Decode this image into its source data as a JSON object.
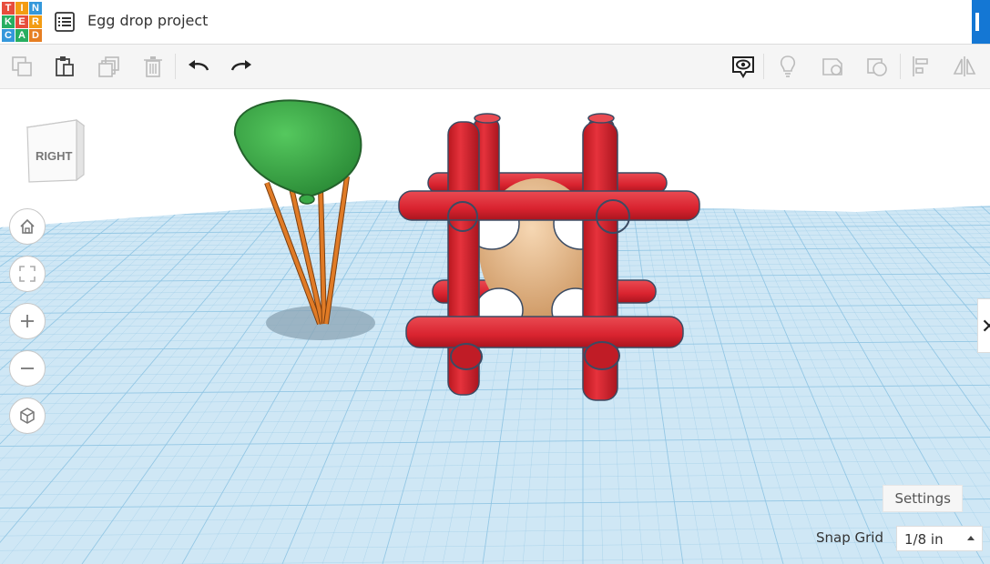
{
  "header": {
    "logo_letters": [
      "T",
      "I",
      "N",
      "K",
      "E",
      "R",
      "C",
      "A",
      "D"
    ],
    "logo_colors": [
      "#e74c3c",
      "#f39c12",
      "#3498db",
      "#27ae60",
      "#e74c3c",
      "#f39c12",
      "#3498db",
      "#27ae60",
      "#e67e22"
    ],
    "project_title": "Egg drop project"
  },
  "toolbar": {
    "left_actions": [
      "copy-icon",
      "paste-icon",
      "duplicate-icon",
      "delete-icon",
      "undo-icon",
      "redo-icon"
    ],
    "right_actions": [
      "show-notes-icon",
      "lightbulb-icon",
      "note-icon",
      "shape-icon",
      "align-icon",
      "mirror-icon"
    ]
  },
  "viewcube": {
    "face_label": "RIGHT"
  },
  "nav": [
    "home-icon",
    "fit-icon",
    "zoom-in-icon",
    "zoom-out-icon",
    "perspective-icon"
  ],
  "bottom": {
    "settings_label": "Settings",
    "snap_label": "Snap Grid",
    "snap_value": "1/8 in"
  },
  "colors": {
    "grid_bg": "#cfe7f5",
    "grid_line": "#8ec4e3",
    "tube_red": "#d9232f",
    "parachute_green": "#3aa947",
    "string_orange": "#e07b26",
    "egg_tan": "#e7b98a",
    "cushion_white": "#ffffff"
  }
}
